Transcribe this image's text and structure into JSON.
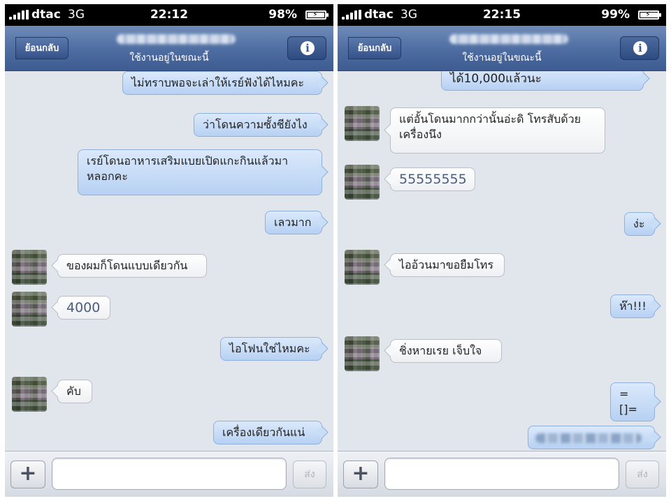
{
  "left": {
    "status": {
      "carrier": "dtac",
      "network": "3G",
      "time": "22:12",
      "battery": "98%",
      "battery_level": 0.98
    },
    "nav": {
      "back_label": "ย้อนกลับ",
      "subtitle": "ใช้งานอยู่ในขณะนี้"
    },
    "messages": {
      "m1": "ไม่ทราบพอจะเล่าให้เรย์ฟังได้ไหมคะ",
      "m2": "ว่าโดนความซั้งชียังไง",
      "m3": "เรย์โดนอาหารเสริมแบยเปิดแกะกินแล้วมา\nหลอกคะ",
      "m4": "เลวมาก",
      "m5": "ของผมก็โดนแบบเดียวกัน",
      "m6": "4000",
      "m7": "ไอโฟนใช่ไหมคะ",
      "m8": "คับ",
      "m9": "เครื่องเดียวกันแน่"
    },
    "input": {
      "send_label": "ส่ง"
    }
  },
  "right": {
    "status": {
      "carrier": "dtac",
      "network": "3G",
      "time": "22:15",
      "battery": "99%",
      "battery_level": 0.99
    },
    "nav": {
      "back_label": "ย้อนกลับ",
      "subtitle": "ใช้งานอยู่ในขณะนี้"
    },
    "messages": {
      "m1": "ได้10,000แล้วนะ",
      "m2": "แต่อั้นโดนมากกว่านั้นอ่ะดิ  โทรสับด้วย\nเครื่องนึง",
      "m3": "55555555",
      "m4": "ง่ะ",
      "m5": "ไออ้วนมาขอยืมโทร",
      "m6": "ห๊า!!!",
      "m7": "ชิ่งหายเรย  เจ็บใจ",
      "m8": "=[]="
    },
    "input": {
      "send_label": "ส่ง"
    }
  },
  "colors": {
    "nav": "#4d6ca1",
    "outgoing_bubble": "#b7d1f3",
    "incoming_bubble": "#ffffff",
    "chat_bg": "#e1e5ec"
  }
}
